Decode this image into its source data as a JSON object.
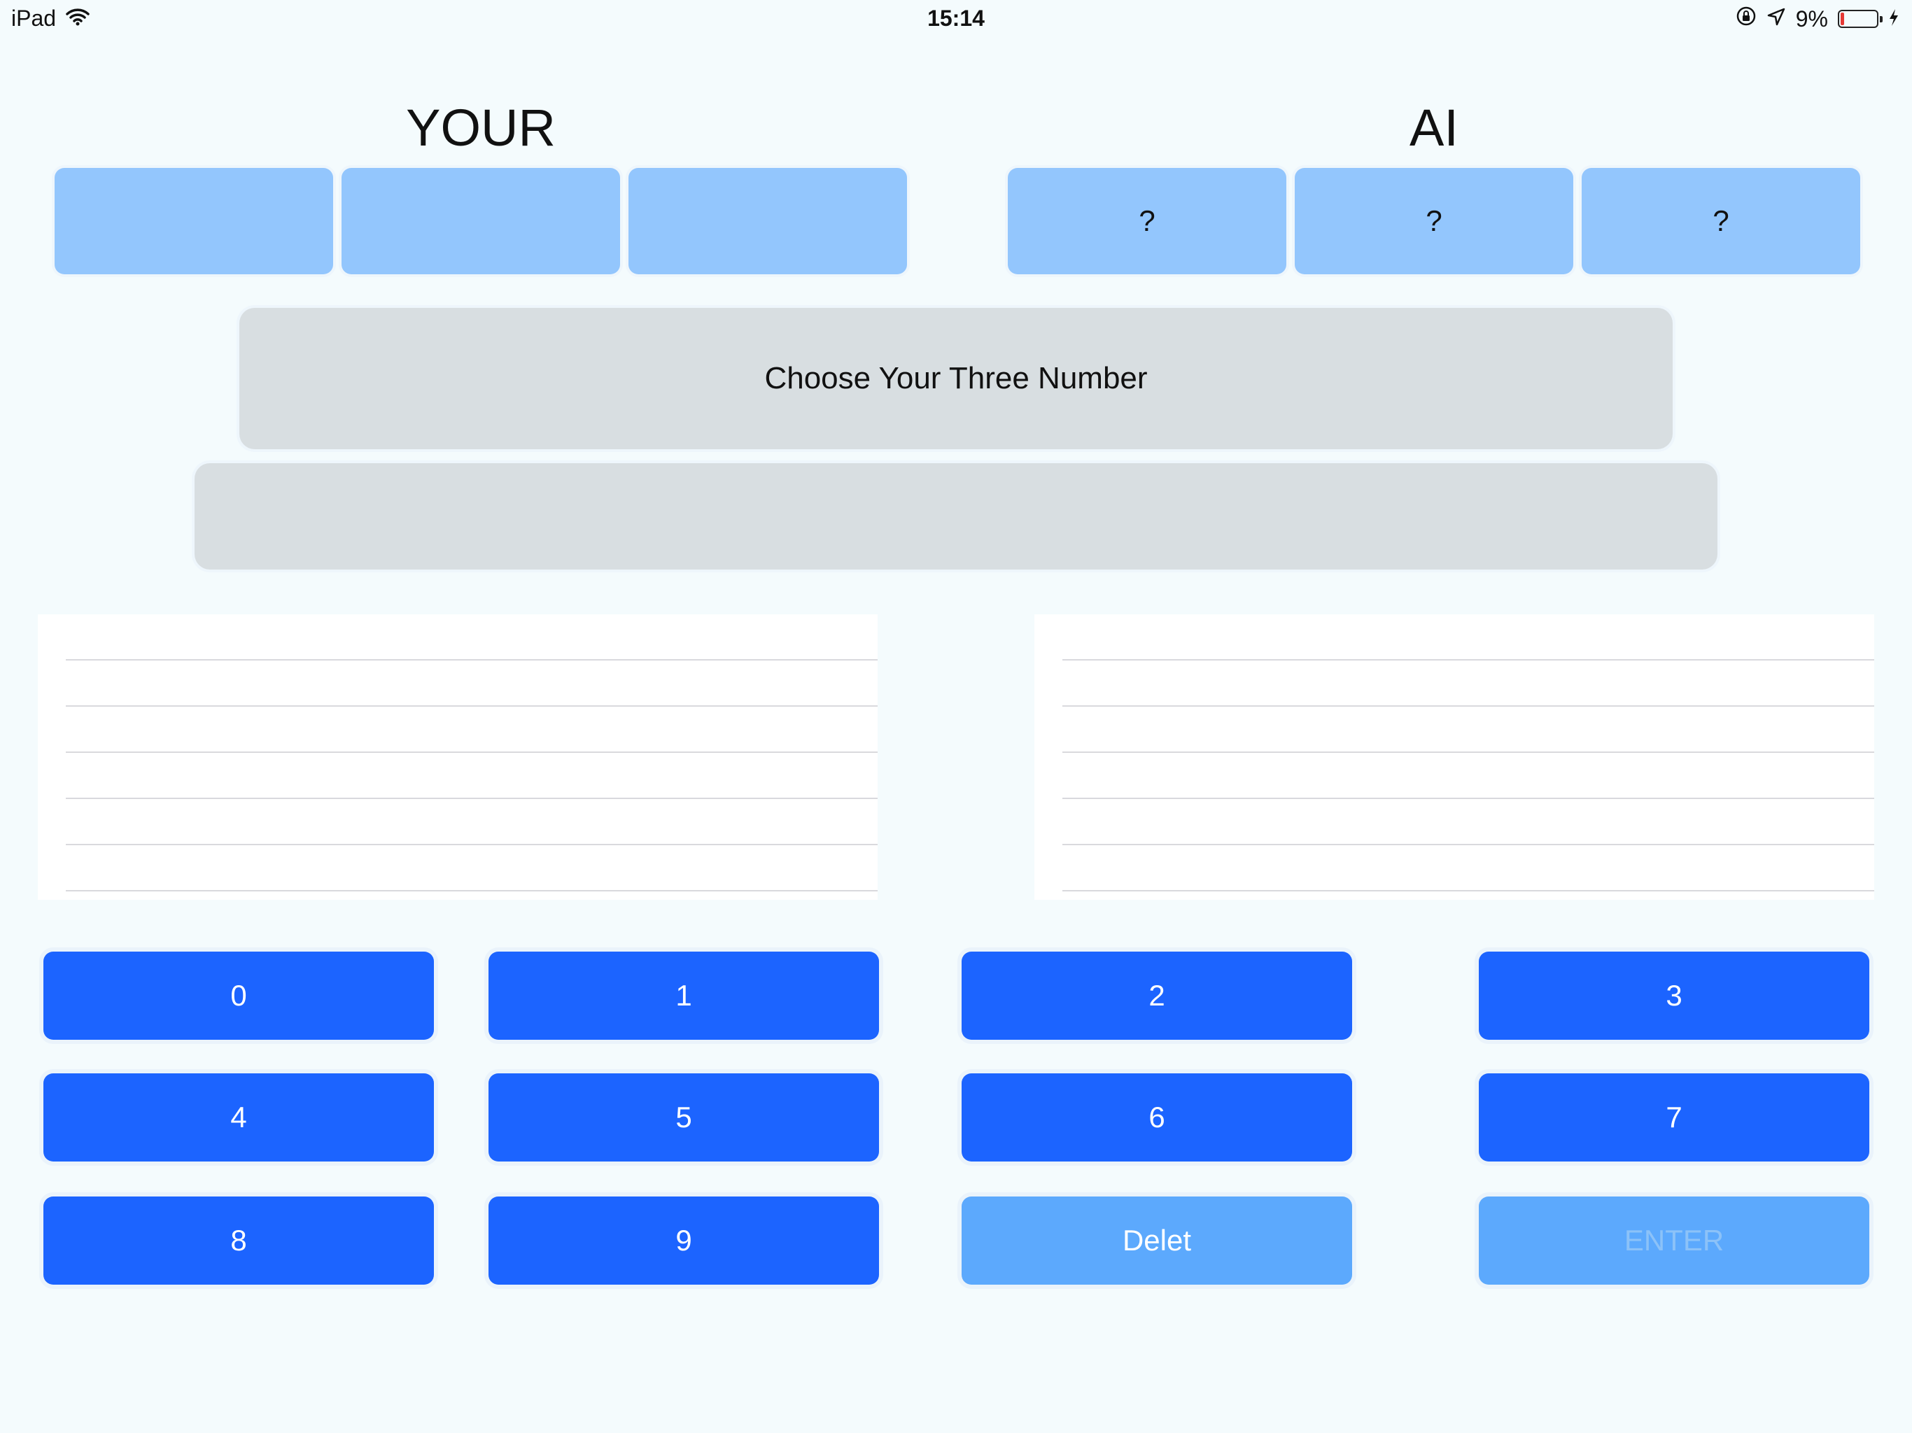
{
  "status_bar": {
    "device": "iPad",
    "time": "15:14",
    "battery": "9%",
    "battery_level": 0.09,
    "battery_color": "#e53935"
  },
  "headers": {
    "your": "YOUR",
    "ai": "AI"
  },
  "your_digits": [
    "",
    "",
    ""
  ],
  "ai_digits": [
    "?",
    "?",
    "?"
  ],
  "messages": {
    "main": "Choose Your Three Number",
    "sub": ""
  },
  "keypad": {
    "keys": [
      "0",
      "1",
      "2",
      "3",
      "4",
      "5",
      "6",
      "7",
      "8",
      "9"
    ],
    "delete": "Delet",
    "enter": "ENTER"
  },
  "colors": {
    "background": "#f4fbfd",
    "digit_box": "#93c6fd",
    "key_active": "#1c64ff",
    "key_inactive": "#5ca9fd",
    "panel": "#d8dee1"
  }
}
